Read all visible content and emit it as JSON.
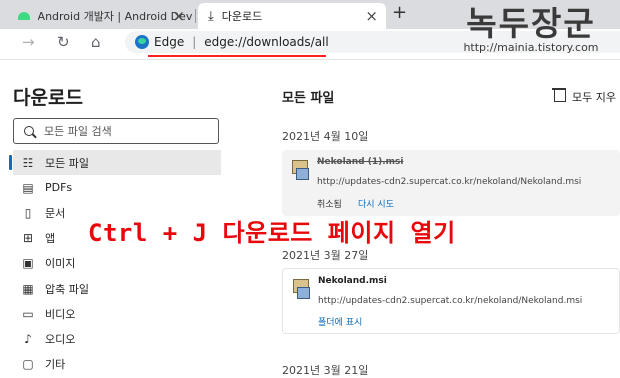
{
  "tabs": [
    {
      "title": "Android 개발자 | Android Deve",
      "active": false
    },
    {
      "title": "다운로드",
      "active": true
    }
  ],
  "toolbar": {
    "new_tab": "+",
    "back": "→",
    "refresh": "↻",
    "home": "⌂"
  },
  "address": {
    "brand": "Edge",
    "separator": "|",
    "url": "edge://downloads/all"
  },
  "watermark": {
    "title": "녹두장군",
    "url": "http://mainia.tistory.com"
  },
  "sidebar": {
    "title": "다운로드",
    "search_placeholder": "모든 파일 검색",
    "items": [
      {
        "label": "모든 파일",
        "icon": "grid-icon",
        "glyph": "☷",
        "selected": true
      },
      {
        "label": "PDFs",
        "icon": "pdf-icon",
        "glyph": "▤",
        "selected": false
      },
      {
        "label": "문서",
        "icon": "document-icon",
        "glyph": "▯",
        "selected": false
      },
      {
        "label": "앱",
        "icon": "apps-icon",
        "glyph": "⊞",
        "selected": false
      },
      {
        "label": "이미지",
        "icon": "image-icon",
        "glyph": "▣",
        "selected": false
      },
      {
        "label": "압축 파일",
        "icon": "archive-icon",
        "glyph": "▦",
        "selected": false
      },
      {
        "label": "비디오",
        "icon": "video-icon",
        "glyph": "▭",
        "selected": false
      },
      {
        "label": "오디오",
        "icon": "audio-icon",
        "glyph": "♪",
        "selected": false
      },
      {
        "label": "기타",
        "icon": "other-icon",
        "glyph": "▢",
        "selected": false
      }
    ]
  },
  "content": {
    "title": "모든 파일",
    "clear_all": "모두 지우",
    "groups": [
      {
        "date": "2021년 4월 10일",
        "file": {
          "name": "Nekoland (1).msi",
          "url": "http://updates-cdn2.supercat.co.kr/nekoland/Nekoland.msi",
          "status": "취소됨",
          "action": "다시 시도"
        }
      },
      {
        "date": "2021년 3월 27일",
        "file": {
          "name": "Nekoland.msi",
          "url": "http://updates-cdn2.supercat.co.kr/nekoland/Nekoland.msi",
          "action": "폴더에 표시"
        }
      },
      {
        "date": "2021년 3월 21일"
      }
    ]
  },
  "overlay": {
    "caption": "Ctrl + J 다운로드 페이지 열기"
  },
  "colors": {
    "accent": "#0f6cbd",
    "overlay_red": "#e8070b",
    "url_underline": "#ff2020"
  }
}
